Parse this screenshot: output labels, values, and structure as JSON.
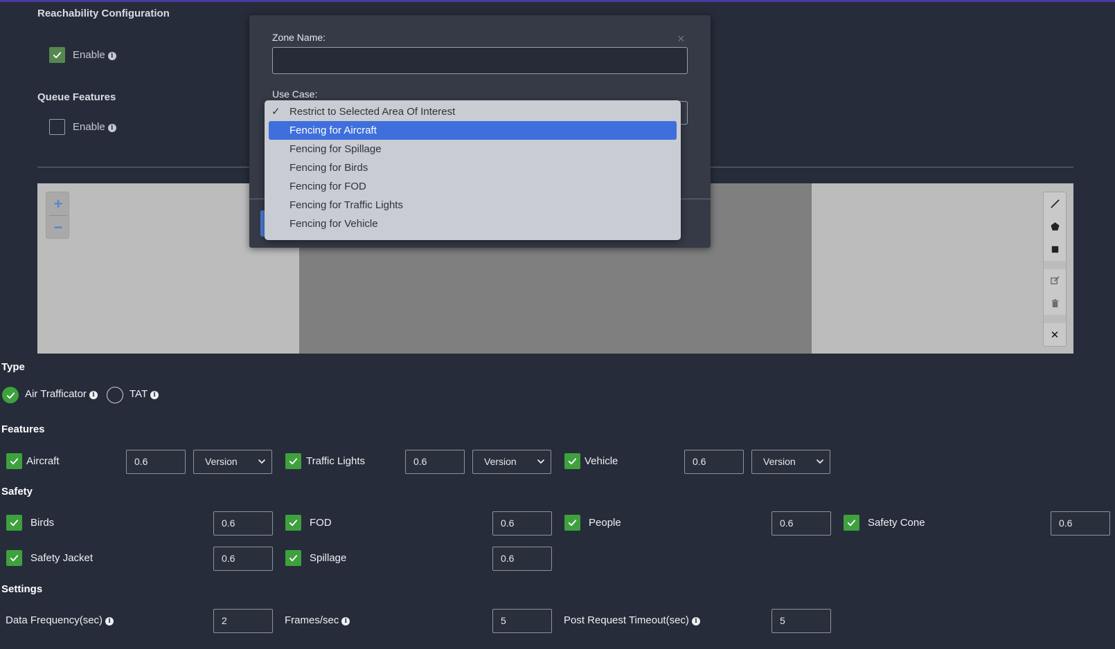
{
  "reachability": {
    "title": "Reachability Configuration",
    "enable_label": "Enable",
    "enabled": true
  },
  "queue": {
    "title": "Queue Features",
    "enable_label": "Enable",
    "enabled": false
  },
  "modal": {
    "zone_name_label": "Zone Name:",
    "zone_name_value": "",
    "use_case_label": "Use Case:",
    "close_glyph": "×"
  },
  "use_case_options": [
    {
      "label": "Restrict to Selected Area Of Interest",
      "checked": true,
      "highlighted": false
    },
    {
      "label": "Fencing for Aircraft",
      "checked": false,
      "highlighted": true
    },
    {
      "label": "Fencing for Spillage",
      "checked": false,
      "highlighted": false
    },
    {
      "label": "Fencing for Birds",
      "checked": false,
      "highlighted": false
    },
    {
      "label": "Fencing for FOD",
      "checked": false,
      "highlighted": false
    },
    {
      "label": "Fencing for Traffic Lights",
      "checked": false,
      "highlighted": false
    },
    {
      "label": "Fencing for Vehicle",
      "checked": false,
      "highlighted": false
    }
  ],
  "map": {
    "zoom_in": "+",
    "zoom_out": "−",
    "close_glyph": "✕"
  },
  "type": {
    "title": "Type",
    "options": [
      {
        "label": "Air Trafficator",
        "selected": true
      },
      {
        "label": "TAT",
        "selected": false
      }
    ]
  },
  "features": {
    "title": "Features",
    "items": [
      {
        "label": "Aircraft",
        "value": "0.6",
        "version": "Version"
      },
      {
        "label": "Traffic Lights",
        "value": "0.6",
        "version": "Version"
      },
      {
        "label": "Vehicle",
        "value": "0.6",
        "version": "Version"
      }
    ]
  },
  "safety": {
    "title": "Safety",
    "items": [
      {
        "label": "Birds",
        "value": "0.6"
      },
      {
        "label": "FOD",
        "value": "0.6"
      },
      {
        "label": "People",
        "value": "0.6"
      },
      {
        "label": "Safety Cone",
        "value": "0.6"
      },
      {
        "label": "Safety Jacket",
        "value": "0.6"
      },
      {
        "label": "Spillage",
        "value": "0.6"
      }
    ]
  },
  "settings": {
    "title": "Settings",
    "items": [
      {
        "label": "Data Frequency(sec)",
        "value": "2"
      },
      {
        "label": "Frames/sec",
        "value": "5"
      },
      {
        "label": "Post Request Timeout(sec)",
        "value": "5"
      }
    ]
  },
  "colors": {
    "accent_green": "#3ea13d",
    "highlight_blue": "#3e6fdc",
    "background": "#262c3a"
  }
}
